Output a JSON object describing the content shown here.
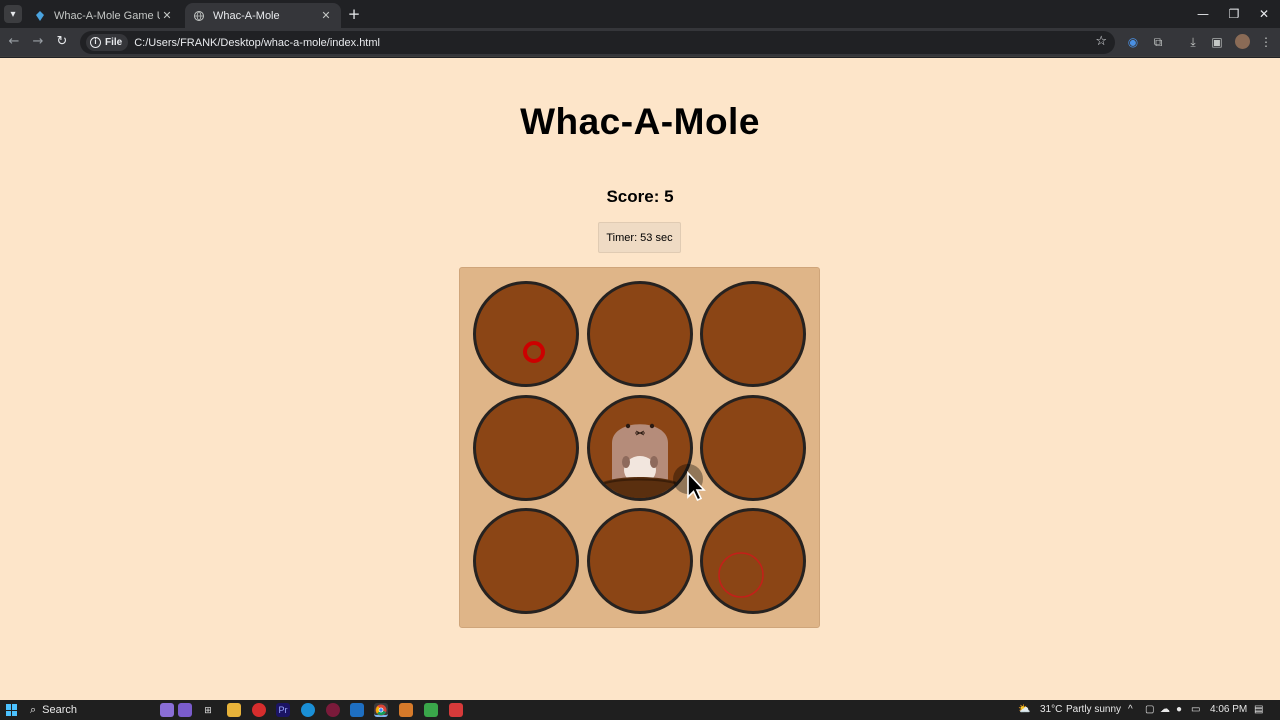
{
  "browser": {
    "tabs": [
      {
        "title": "Whac-A-Mole Game Using HTML",
        "active": false
      },
      {
        "title": "Whac-A-Mole",
        "active": true
      }
    ],
    "site_chip": "File",
    "url": "C:/Users/FRANK/Desktop/whac-a-mole/index.html"
  },
  "game": {
    "title": "Whac-A-Mole",
    "score_text": "Score: 5",
    "timer_text": "Timer: 53 sec",
    "active_mole_hole": 5,
    "holes": 9
  },
  "taskbar": {
    "search_label": "Search",
    "weather": "31°C",
    "weather_desc": "Partly sunny",
    "time": "4:06 PM"
  },
  "colors": {
    "page_bg": "#fde5c9",
    "board_bg": "#dfb588",
    "hole_fill": "#8b4515",
    "hole_border": "#262220",
    "hit_marker": "#cc0000"
  }
}
